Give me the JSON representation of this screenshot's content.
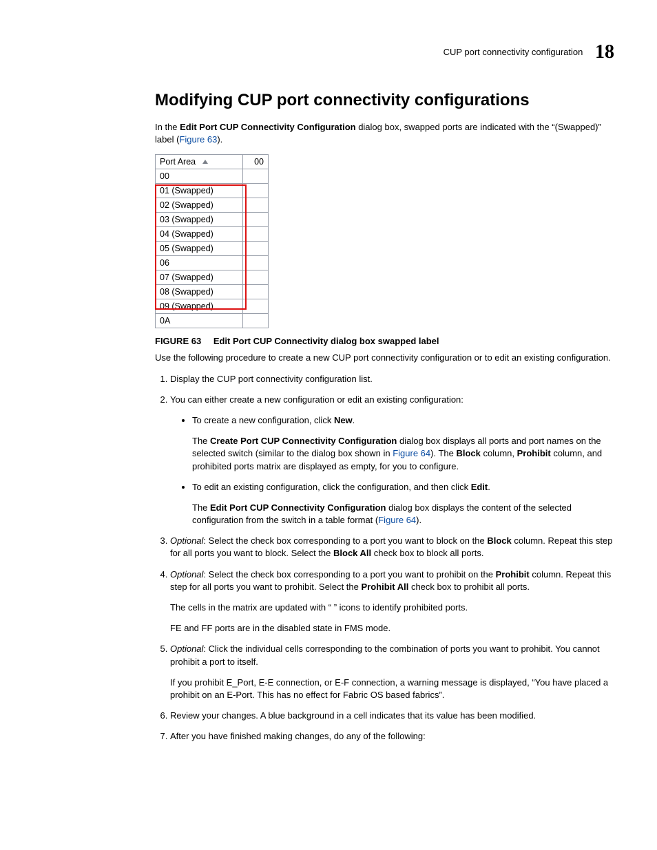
{
  "header": {
    "running_title": "CUP port connectivity configuration",
    "chapter_number": "18"
  },
  "section_title": "Modifying CUP port connectivity configurations",
  "intro": {
    "pre": "In the ",
    "bold1": "Edit Port CUP Connectivity Configuration",
    "mid": " dialog box, swapped ports are indicated with the “(Swapped)” label (",
    "link": "Figure 63",
    "post": ")."
  },
  "port_table": {
    "header_col1": "Port Area",
    "header_col2": "00",
    "rows": [
      "00",
      "01 (Swapped)",
      "02 (Swapped)",
      "03 (Swapped)",
      "04 (Swapped)",
      "05 (Swapped)",
      "06",
      "07 (Swapped)",
      "08 (Swapped)",
      "09 (Swapped)",
      "0A"
    ]
  },
  "figure": {
    "label": "FIGURE 63",
    "caption": "Edit Port CUP Connectivity dialog box swapped label"
  },
  "after_figure": "Use the following procedure to create a new CUP port connectivity configuration or to edit an existing configuration.",
  "steps": {
    "s1": "Display the CUP port connectivity configuration list.",
    "s2_intro": "You can either create a new configuration or edit an existing configuration:",
    "s2_b1_pre": "To create a new configuration, click ",
    "s2_b1_bold": "New",
    "s2_b1_post": ".",
    "s2_b1_p_pre": "The ",
    "s2_b1_p_bold1": "Create Port CUP Connectivity Configuration",
    "s2_b1_p_mid": " dialog box displays all ports and port names on the selected switch (similar to the dialog box shown in ",
    "s2_b1_p_link": "Figure 64",
    "s2_b1_p_mid2": "). The ",
    "s2_b1_p_bold2": "Block",
    "s2_b1_p_mid3": " column, ",
    "s2_b1_p_bold3": "Prohibit",
    "s2_b1_p_post": " column, and prohibited ports matrix are displayed as empty, for you to configure.",
    "s2_b2_pre": "To edit an existing configuration, click the configuration, and then click ",
    "s2_b2_bold": "Edit",
    "s2_b2_post": ".",
    "s2_b2_p_pre": "The ",
    "s2_b2_p_bold": "Edit Port CUP Connectivity Configuration",
    "s2_b2_p_mid": " dialog box displays the content of the selected configuration from the switch in a table format (",
    "s2_b2_p_link": "Figure 64",
    "s2_b2_p_post": ").",
    "s3_opt": "Optional",
    "s3_pre": ": Select the check box corresponding to a port you want to block on the ",
    "s3_bold1": "Block",
    "s3_mid": " column. Repeat this step for all ports you want to block. Select the ",
    "s3_bold2": "Block All",
    "s3_post": " check box to block all ports.",
    "s4_opt": "Optional",
    "s4_pre": ": Select the check box corresponding to a port you want to prohibit on the ",
    "s4_bold1": "Prohibit",
    "s4_mid": " column. Repeat this step for all ports you want to prohibit. Select the ",
    "s4_bold2": "Prohibit All",
    "s4_post": " check box to prohibit all ports.",
    "s4_p1": "The cells in the matrix are updated with “   ” icons to identify prohibited ports.",
    "s4_p2": "FE and FF ports are in the disabled state in FMS mode.",
    "s5_opt": "Optional",
    "s5_body": ": Click the individual cells corresponding to the combination of ports you want to prohibit. You cannot prohibit a port to itself.",
    "s5_p": "If you prohibit E_Port, E-E connection, or E-F connection, a warning message is displayed, “You have placed a prohibit on an E-Port. This has no effect for Fabric OS based fabrics”.",
    "s6": "Review your changes. A blue background in a cell indicates that its value has been modified.",
    "s7": "After you have finished making changes, do any of the following:"
  }
}
